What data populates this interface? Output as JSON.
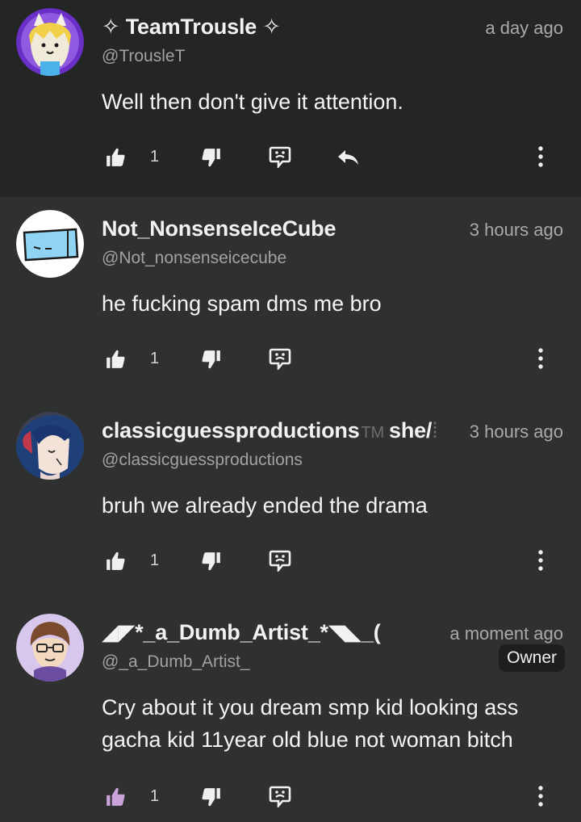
{
  "comments": [
    {
      "name": "✧ TeamTrousle ✧",
      "handle": "@TrousleT",
      "time": "a day ago",
      "text": "Well then don't give it attention.",
      "likes": "1"
    },
    {
      "name": "Not_NonsenseIceCube",
      "handle": "@Not_nonsenseicecube",
      "time": "3 hours ago",
      "text": "he fucking spam dms me bro",
      "likes": "1"
    },
    {
      "name": "classicguessproductions",
      "name_tm": "TM",
      "name_suffix": "she/",
      "handle": "@classicguessproductions",
      "time": "3 hours ago",
      "text": "bruh we already ended the drama",
      "likes": "1"
    },
    {
      "name": "◢◤*_a_Dumb_Artist_*◥◣_(",
      "handle": "@_a_Dumb_Artist_",
      "time": "a moment ago",
      "badge": "Owner",
      "text": "Cry about it you dream smp kid looking ass gacha kid 11year old blue not woman bitch",
      "likes": "1"
    }
  ],
  "colors": {
    "background": "#2f3030",
    "highlighted_comment": "#242525",
    "primary_text": "#f4f4f4",
    "secondary_text": "#a9a9a9",
    "badge_bg": "#1d1e1e"
  },
  "icons": [
    "thumbs-up-icon",
    "thumbs-down-icon",
    "flag-face-icon",
    "reply-icon",
    "more-vertical-icon"
  ]
}
